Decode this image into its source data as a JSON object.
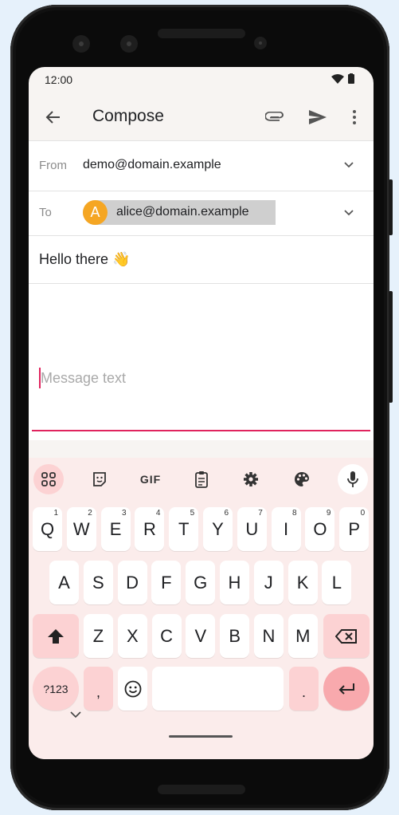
{
  "status": {
    "time": "12:00"
  },
  "appbar": {
    "title": "Compose"
  },
  "compose": {
    "from_label": "From",
    "from_value": "demo@domain.example",
    "to_label": "To",
    "to_avatar": "A",
    "to_value": "alice@domain.example",
    "subject": "Hello there 👋",
    "body_placeholder": "Message text"
  },
  "keyboard": {
    "toolbar": {
      "gif_label": "GIF"
    },
    "row1": [
      {
        "k": "Q",
        "h": "1"
      },
      {
        "k": "W",
        "h": "2"
      },
      {
        "k": "E",
        "h": "3"
      },
      {
        "k": "R",
        "h": "4"
      },
      {
        "k": "T",
        "h": "5"
      },
      {
        "k": "Y",
        "h": "6"
      },
      {
        "k": "U",
        "h": "7"
      },
      {
        "k": "I",
        "h": "8"
      },
      {
        "k": "O",
        "h": "9"
      },
      {
        "k": "P",
        "h": "0"
      }
    ],
    "row2": [
      "A",
      "S",
      "D",
      "F",
      "G",
      "H",
      "J",
      "K",
      "L"
    ],
    "row3": [
      "Z",
      "X",
      "C",
      "V",
      "B",
      "N",
      "M"
    ],
    "symbols_label": "?123",
    "comma": ",",
    "period": "."
  },
  "colors": {
    "accent": "#e0245e",
    "keyboard_bg": "#fbeceb",
    "pink_key": "#fcd2d3",
    "avatar": "#f5a623"
  }
}
